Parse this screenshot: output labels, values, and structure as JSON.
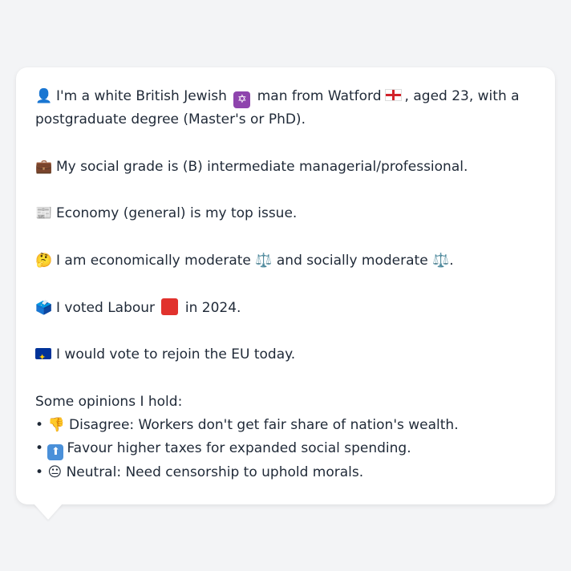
{
  "profile": {
    "line1_a": "I'm a white British Jewish",
    "line1_b": "man from Watford",
    "line1_c": ", aged 23, with a",
    "line2": "postgraduate degree (Master's or PhD).",
    "social_grade": "My social grade is (B) intermediate managerial/professional.",
    "top_issue": "Economy (general) is my top issue.",
    "stance_a": "I am economically moderate",
    "stance_b": "and socially moderate",
    "stance_c": ".",
    "vote_a": "I voted Labour",
    "vote_b": "in 2024.",
    "eu": "I would vote to rejoin the EU today.",
    "opinions_heading": "Some opinions I hold:",
    "bullet": "•",
    "opinion1": "Disagree: Workers don't get fair share of nation's wealth.",
    "opinion2": "Favour higher taxes for expanded social spending.",
    "opinion3": "Neutral: Need censorship to uphold morals."
  },
  "icons": {
    "person": "👤",
    "star_of_david": "✡",
    "briefcase": "💼",
    "newspaper": "📰",
    "thinking": "🤔",
    "scales": "⚖️",
    "ballot_box": "🗳️",
    "thumbs_down": "👎",
    "arrow_up": "⬆",
    "neutral_face": "😐"
  },
  "colors": {
    "background": "#f3f4f6",
    "bubble": "#ffffff",
    "text": "#1f2937"
  }
}
